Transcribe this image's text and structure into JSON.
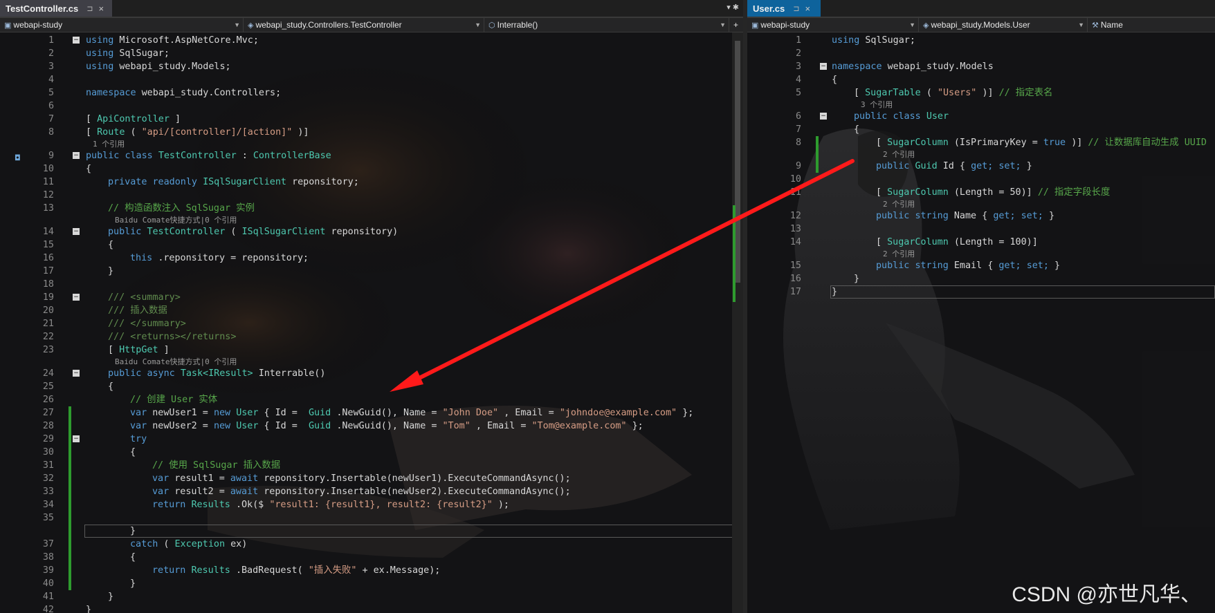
{
  "left": {
    "tab": {
      "title": "TestController.cs",
      "pin": "⊐",
      "close": "×"
    },
    "tab_tools": "▾ ✱",
    "nav": {
      "project": "webapi-study",
      "type": "webapi_study.Controllers.TestController",
      "member": "Interrable()"
    },
    "lines": [
      {
        "n": "1",
        "fold": "-",
        "code": [
          [
            "kw",
            "using"
          ],
          [
            "",
            "Microsoft.AspNetCore.Mvc;"
          ]
        ]
      },
      {
        "n": "2",
        "code": [
          [
            "kw",
            "using"
          ],
          [
            "",
            "SqlSugar;"
          ]
        ]
      },
      {
        "n": "3",
        "code": [
          [
            "kw",
            "using"
          ],
          [
            "",
            "webapi_study.Models;"
          ]
        ]
      },
      {
        "n": "4",
        "code": []
      },
      {
        "n": "5",
        "code": [
          [
            "kw",
            "namespace"
          ],
          [
            "",
            "webapi_study.Controllers;"
          ]
        ]
      },
      {
        "n": "6",
        "code": []
      },
      {
        "n": "7",
        "code": [
          [
            "",
            "["
          ],
          [
            "at",
            "ApiController"
          ],
          [
            "",
            "]"
          ]
        ]
      },
      {
        "n": "8",
        "code": [
          [
            "",
            "["
          ],
          [
            "at",
            "Route"
          ],
          [
            "",
            "("
          ],
          [
            "st",
            "\"api/[controller]/[action]\""
          ],
          [
            "",
            ")]"
          ]
        ]
      },
      {
        "ref": "1 个引用"
      },
      {
        "n": "9",
        "fold": "-",
        "code": [
          [
            "kw",
            "public"
          ],
          [
            "kw",
            "class"
          ],
          [
            "ty",
            "TestController"
          ],
          [
            "",
            ":"
          ],
          [
            "ty",
            "ControllerBase"
          ]
        ]
      },
      {
        "n": "10",
        "code": [
          [
            "",
            "{"
          ]
        ]
      },
      {
        "n": "11",
        "indent": 1,
        "code": [
          [
            "kw",
            "private"
          ],
          [
            "kw",
            "readonly"
          ],
          [
            "ty",
            "ISqlSugarClient"
          ],
          [
            "",
            "reponsitory;"
          ]
        ]
      },
      {
        "n": "12",
        "code": []
      },
      {
        "n": "13",
        "indent": 1,
        "code": [
          [
            "cm",
            "// 构造函数注入 SqlSugar 实例"
          ]
        ]
      },
      {
        "ref": "Baidu Comate快捷方式|0 个引用",
        "indent": 1
      },
      {
        "n": "14",
        "indent": 1,
        "fold": "-",
        "code": [
          [
            "kw",
            "public"
          ],
          [
            "ty",
            "TestController"
          ],
          [
            "",
            "("
          ],
          [
            "ty",
            "ISqlSugarClient"
          ],
          [
            "",
            "reponsitory)"
          ]
        ]
      },
      {
        "n": "15",
        "indent": 1,
        "code": [
          [
            "",
            "{"
          ]
        ]
      },
      {
        "n": "16",
        "indent": 2,
        "code": [
          [
            "kw",
            "this"
          ],
          [
            "",
            ".reponsitory = reponsitory;"
          ]
        ]
      },
      {
        "n": "17",
        "indent": 1,
        "code": [
          [
            "",
            "}"
          ]
        ]
      },
      {
        "n": "18",
        "code": []
      },
      {
        "n": "19",
        "indent": 1,
        "fold": "-",
        "code": [
          [
            "doc",
            "/// <summary>"
          ]
        ]
      },
      {
        "n": "20",
        "indent": 1,
        "code": [
          [
            "doc",
            "/// 插入数据"
          ]
        ]
      },
      {
        "n": "21",
        "indent": 1,
        "code": [
          [
            "doc",
            "/// </summary>"
          ]
        ]
      },
      {
        "n": "22",
        "indent": 1,
        "code": [
          [
            "doc",
            "/// <returns></returns>"
          ]
        ]
      },
      {
        "n": "23",
        "indent": 1,
        "code": [
          [
            "",
            "["
          ],
          [
            "at",
            "HttpGet"
          ],
          [
            "",
            "]"
          ]
        ]
      },
      {
        "ref": "Baidu Comate快捷方式|0 个引用",
        "indent": 1
      },
      {
        "n": "24",
        "indent": 1,
        "fold": "-",
        "code": [
          [
            "kw",
            "public"
          ],
          [
            "kw",
            "async"
          ],
          [
            "ty",
            "Task<IResult>"
          ],
          [
            "",
            "Interrable()"
          ]
        ]
      },
      {
        "n": "25",
        "indent": 1,
        "code": [
          [
            "",
            "{"
          ]
        ]
      },
      {
        "n": "26",
        "indent": 2,
        "code": [
          [
            "cm",
            "// 创建 User 实体"
          ]
        ]
      },
      {
        "n": "27",
        "indent": 2,
        "code": [
          [
            "kw",
            "var"
          ],
          [
            "",
            "newUser1 ="
          ],
          [
            "kw",
            "new"
          ],
          [
            "ty",
            "User"
          ],
          [
            "",
            "{ Id = "
          ],
          [
            "ty",
            "Guid"
          ],
          [
            "",
            ".NewGuid(), Name ="
          ],
          [
            "st",
            "\"John Doe\""
          ],
          [
            "",
            ", Email ="
          ],
          [
            "st",
            "\"johndoe@example.com\""
          ],
          [
            "",
            "};"
          ]
        ]
      },
      {
        "n": "28",
        "indent": 2,
        "code": [
          [
            "kw",
            "var"
          ],
          [
            "",
            "newUser2 ="
          ],
          [
            "kw",
            "new"
          ],
          [
            "ty",
            "User"
          ],
          [
            "",
            "{ Id = "
          ],
          [
            "ty",
            "Guid"
          ],
          [
            "",
            ".NewGuid(), Name ="
          ],
          [
            "st",
            "\"Tom\""
          ],
          [
            "",
            ", Email ="
          ],
          [
            "st",
            "\"Tom@example.com\""
          ],
          [
            "",
            "};"
          ]
        ]
      },
      {
        "n": "29",
        "indent": 2,
        "fold": "-",
        "code": [
          [
            "kw",
            "try"
          ]
        ]
      },
      {
        "n": "30",
        "indent": 2,
        "code": [
          [
            "",
            "{"
          ]
        ]
      },
      {
        "n": "31",
        "indent": 3,
        "code": [
          [
            "cm",
            "// 使用 SqlSugar 插入数据"
          ]
        ]
      },
      {
        "n": "32",
        "indent": 3,
        "code": [
          [
            "kw",
            "var"
          ],
          [
            "",
            "result1 ="
          ],
          [
            "kw",
            "await"
          ],
          [
            "",
            "reponsitory.Insertable(newUser1).ExecuteCommandAsync();"
          ]
        ]
      },
      {
        "n": "33",
        "indent": 3,
        "code": [
          [
            "kw",
            "var"
          ],
          [
            "",
            "result2 ="
          ],
          [
            "kw",
            "await"
          ],
          [
            "",
            "reponsitory.Insertable(newUser2).ExecuteCommandAsync();"
          ]
        ]
      },
      {
        "n": "34",
        "indent": 3,
        "code": [
          [
            "kw",
            "return"
          ],
          [
            "ty",
            "Results"
          ],
          [
            "",
            ".Ok($"
          ],
          [
            "st",
            "\"result1: {result1}, result2: {result2}\""
          ],
          [
            "",
            ");"
          ]
        ]
      },
      {
        "n": "35",
        "code": []
      },
      {
        "n": "",
        "indent": 2,
        "current": true,
        "code": [
          [
            "",
            "}"
          ]
        ]
      },
      {
        "n": "37",
        "indent": 2,
        "code": [
          [
            "kw",
            "catch"
          ],
          [
            "",
            "("
          ],
          [
            "ty",
            "Exception"
          ],
          [
            "",
            "ex)"
          ]
        ]
      },
      {
        "n": "38",
        "indent": 2,
        "code": [
          [
            "",
            "{"
          ]
        ]
      },
      {
        "n": "39",
        "indent": 3,
        "code": [
          [
            "kw",
            "return"
          ],
          [
            "ty",
            "Results"
          ],
          [
            "",
            ".BadRequest("
          ],
          [
            "st",
            "\"插入失败\""
          ],
          [
            "",
            "+ ex.Message);"
          ]
        ]
      },
      {
        "n": "40",
        "indent": 2,
        "code": [
          [
            "",
            "}"
          ]
        ]
      },
      {
        "n": "41",
        "indent": 1,
        "code": [
          [
            "",
            "}"
          ]
        ]
      },
      {
        "n": "42",
        "code": [
          [
            "",
            "}"
          ]
        ]
      }
    ]
  },
  "right": {
    "tab": {
      "title": "User.cs",
      "pin": "⊐",
      "close": "×"
    },
    "nav": {
      "project": "webapi-study",
      "type": "webapi_study.Models.User",
      "member": "Name"
    },
    "lines": [
      {
        "n": "1",
        "code": [
          [
            "kw",
            "using"
          ],
          [
            "",
            "SqlSugar;"
          ]
        ]
      },
      {
        "n": "2",
        "code": []
      },
      {
        "n": "3",
        "fold": "-",
        "code": [
          [
            "kw",
            "namespace"
          ],
          [
            "",
            "webapi_study.Models"
          ]
        ]
      },
      {
        "n": "4",
        "code": [
          [
            "",
            "{"
          ]
        ]
      },
      {
        "n": "5",
        "indent": 1,
        "code": [
          [
            "",
            "["
          ],
          [
            "at",
            "SugarTable"
          ],
          [
            "",
            "("
          ],
          [
            "st",
            "\"Users\""
          ],
          [
            "",
            ")]"
          ],
          [
            "cm",
            "// 指定表名"
          ]
        ]
      },
      {
        "ref": "3 个引用",
        "indent": 1
      },
      {
        "n": "6",
        "indent": 1,
        "fold": "-",
        "code": [
          [
            "kw",
            "public"
          ],
          [
            "kw",
            "class"
          ],
          [
            "ty",
            "User"
          ]
        ]
      },
      {
        "n": "7",
        "indent": 1,
        "code": [
          [
            "",
            "{"
          ]
        ]
      },
      {
        "n": "8",
        "indent": 2,
        "code": [
          [
            "",
            "["
          ],
          [
            "at",
            "SugarColumn"
          ],
          [
            "",
            "(IsPrimaryKey ="
          ],
          [
            "kw",
            "true"
          ],
          [
            "",
            ")]"
          ],
          [
            "cm",
            "// 让数据库自动生成 UUID"
          ]
        ]
      },
      {
        "ref": "2 个引用",
        "indent": 2
      },
      {
        "n": "9",
        "indent": 2,
        "code": [
          [
            "kw",
            "public"
          ],
          [
            "ty",
            "Guid"
          ],
          [
            "",
            "Id {"
          ],
          [
            "kw",
            "get;"
          ],
          [
            "kw",
            "set;"
          ],
          [
            "",
            "}"
          ]
        ]
      },
      {
        "n": "10",
        "code": []
      },
      {
        "n": "11",
        "indent": 2,
        "code": [
          [
            "",
            "["
          ],
          [
            "at",
            "SugarColumn"
          ],
          [
            "",
            "(Length = 50)]"
          ],
          [
            "cm",
            "// 指定字段长度"
          ]
        ]
      },
      {
        "ref": "2 个引用",
        "indent": 2
      },
      {
        "n": "12",
        "indent": 2,
        "code": [
          [
            "kw",
            "public"
          ],
          [
            "kw",
            "string"
          ],
          [
            "",
            "Name {"
          ],
          [
            "kw",
            "get;"
          ],
          [
            "kw",
            "set;"
          ],
          [
            "",
            "}"
          ]
        ]
      },
      {
        "n": "13",
        "code": []
      },
      {
        "n": "14",
        "indent": 2,
        "code": [
          [
            "",
            "["
          ],
          [
            "at",
            "SugarColumn"
          ],
          [
            "",
            "(Length = 100)]"
          ]
        ]
      },
      {
        "ref": "2 个引用",
        "indent": 2
      },
      {
        "n": "15",
        "indent": 2,
        "code": [
          [
            "kw",
            "public"
          ],
          [
            "kw",
            "string"
          ],
          [
            "",
            "Email {"
          ],
          [
            "kw",
            "get;"
          ],
          [
            "kw",
            "set;"
          ],
          [
            "",
            "}"
          ]
        ]
      },
      {
        "n": "16",
        "indent": 1,
        "code": [
          [
            "",
            "}"
          ]
        ]
      },
      {
        "n": "17",
        "current": true,
        "code": [
          [
            "",
            "}"
          ]
        ]
      }
    ]
  },
  "watermark": "CSDN @亦世凡华、",
  "colors": {
    "keyword": "#569cd6",
    "type": "#4ec9b0",
    "string": "#d69d85",
    "comment": "#57a64a",
    "arrow": "#ff1a1a",
    "active_tab": "#0e639c"
  }
}
